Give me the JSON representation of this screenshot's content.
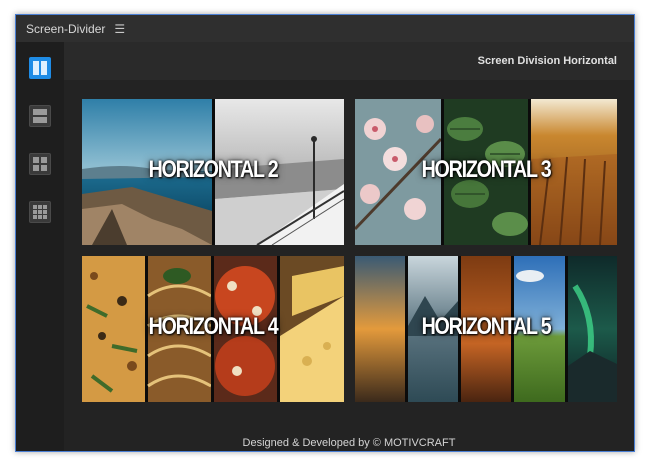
{
  "app": {
    "title": "Screen-Divider",
    "menu_icon": "hamburger-icon"
  },
  "sidebar": {
    "items": [
      {
        "name": "vertical-2-split-icon",
        "active": true
      },
      {
        "name": "horizontal-2-split-icon",
        "active": false
      },
      {
        "name": "grid-2x2-icon",
        "active": false
      },
      {
        "name": "grid-3x3-icon",
        "active": false
      }
    ]
  },
  "header": {
    "title": "Screen Division Horizontal"
  },
  "tiles": [
    {
      "label": "HORIZONTAL 2"
    },
    {
      "label": "HORIZONTAL 3"
    },
    {
      "label": "HORIZONTAL 4"
    },
    {
      "label": "HORIZONTAL 5"
    }
  ],
  "footer": {
    "text": "Designed & Developed by © MOTIVCRAFT"
  },
  "colors": {
    "accent": "#1f8ce6",
    "background": "#232323",
    "header": "#2a2a2a",
    "sidebar": "#1e1e1e",
    "window_border": "#4a7fd4"
  }
}
